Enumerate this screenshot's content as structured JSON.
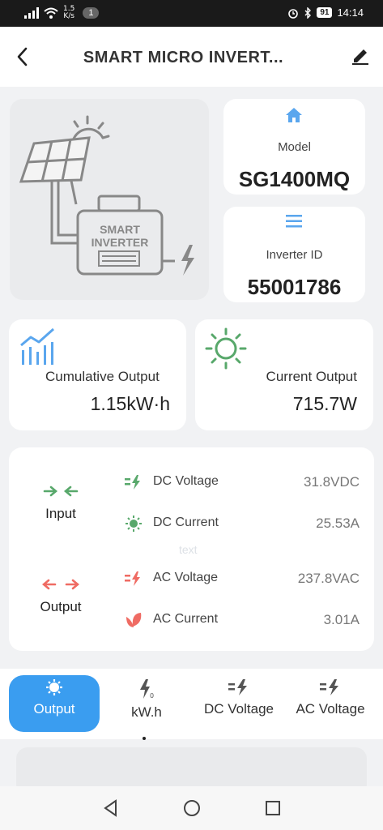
{
  "status_bar": {
    "net_speed_value": "1.5",
    "net_speed_unit": "K/s",
    "notification_count": "1",
    "battery": "91",
    "time": "14:14"
  },
  "header": {
    "title": "SMART MICRO INVERT..."
  },
  "illustration": {
    "label_line1": "SMART",
    "label_line2": "INVERTER"
  },
  "model": {
    "label": "Model",
    "value": "SG1400MQ"
  },
  "inverter": {
    "label": "Inverter ID",
    "value": "55001786"
  },
  "cumulative": {
    "label": "Cumulative Output",
    "value": "1.15kW·h"
  },
  "current": {
    "label": "Current Output",
    "value": "715.7W"
  },
  "params": {
    "input_label": "Input",
    "output_label": "Output",
    "placeholder": "text",
    "rows": [
      {
        "name": "DC Voltage",
        "value": "31.8VDC",
        "icon": "voltage-icon",
        "color": "#58a86b"
      },
      {
        "name": "DC Current",
        "value": "25.53A",
        "icon": "sun-current-icon",
        "color": "#58a86b"
      },
      {
        "name": "AC Voltage",
        "value": "237.8VAC",
        "icon": "voltage-icon",
        "color": "#ef6b63"
      },
      {
        "name": "AC Current",
        "value": "3.01A",
        "icon": "leaf-icon",
        "color": "#ef6b63"
      }
    ]
  },
  "tabs": [
    {
      "label": "Output",
      "icon": "gear-sun-icon",
      "active": true
    },
    {
      "label": "kW.h",
      "icon": "energy-icon",
      "active": false
    },
    {
      "label": "DC Voltage",
      "icon": "voltage-icon",
      "active": false
    },
    {
      "label": "AC Voltage",
      "icon": "voltage-icon",
      "active": false
    }
  ],
  "colors": {
    "accent": "#3a9df0",
    "green": "#58a86b",
    "red": "#ef6b63",
    "blue_icon": "#5aa6ee"
  }
}
